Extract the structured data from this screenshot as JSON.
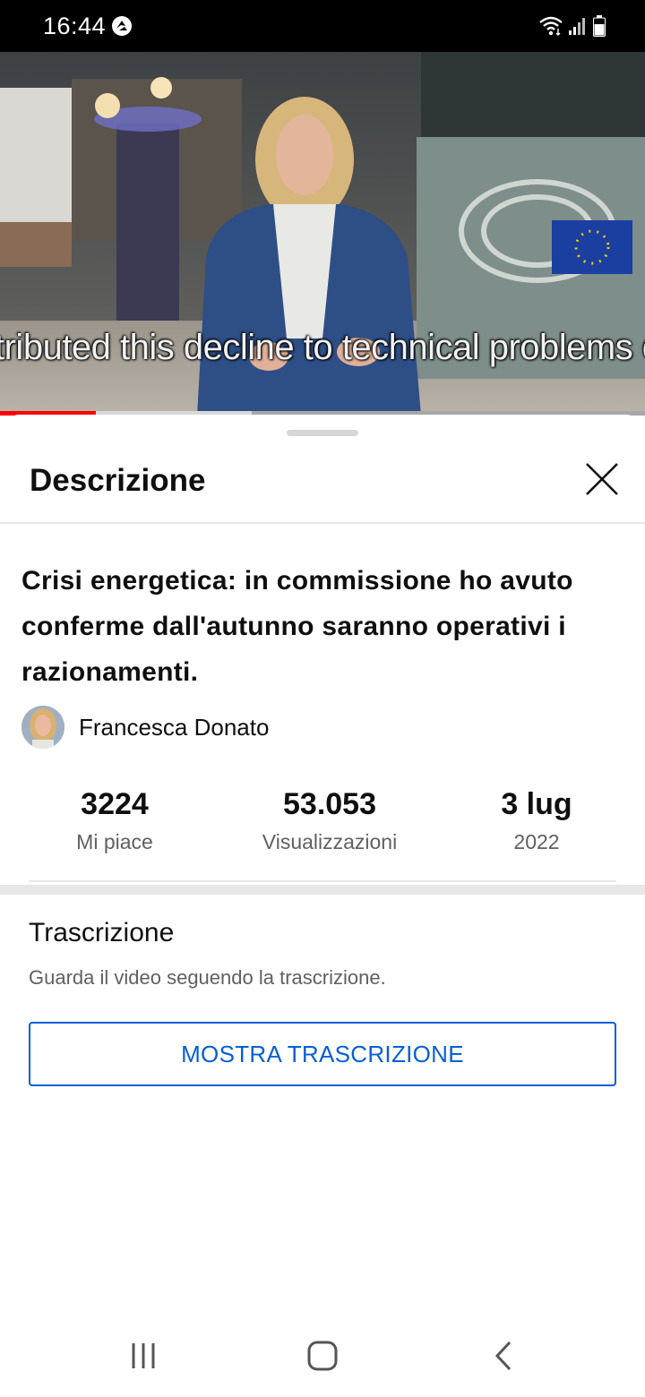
{
  "status_bar": {
    "time": "16:44",
    "icons": [
      "notification-badge-icon",
      "wifi-icon",
      "signal-icon",
      "battery-icon"
    ]
  },
  "video": {
    "subtitle": "tributed this decline to technical problems due to",
    "progress_played": 0.149,
    "progress_buffered": 0.39
  },
  "sheet": {
    "title": "Descrizione",
    "close_icon": "close-icon"
  },
  "description": {
    "title": "Crisi energetica: in commissione ho avuto conferme dall'autunno saranno operativi i razionamenti.",
    "channel_name": "Francesca Donato",
    "stats": [
      {
        "value": "3224",
        "label": "Mi piace"
      },
      {
        "value": "53.053",
        "label": "Visualizzazioni"
      },
      {
        "value": "3 lug",
        "label": "2022"
      }
    ]
  },
  "transcript": {
    "title": "Trascrizione",
    "description": "Guarda il video seguendo la trascrizione.",
    "button_label": "MOSTRA TRASCRIZIONE"
  },
  "nav_bar": {
    "buttons": [
      "recent-apps-icon",
      "home-icon",
      "back-icon"
    ]
  },
  "colors": {
    "accent": "#065fd4",
    "progress": "#ff0000",
    "status_bar": "#000000"
  }
}
